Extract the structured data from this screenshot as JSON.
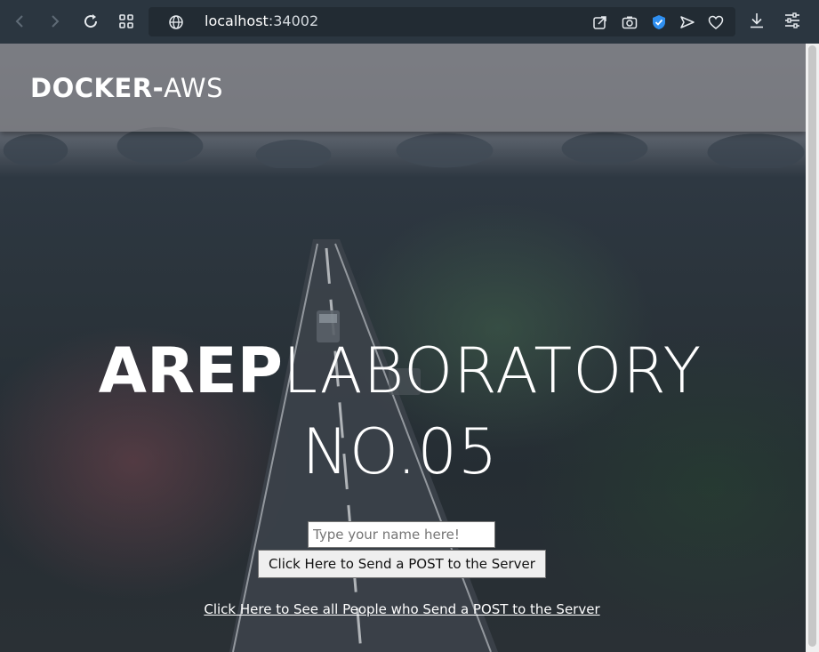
{
  "browser": {
    "url_host": "localhost",
    "url_port": ":34002",
    "icons": {
      "back": "back-arrow-icon",
      "forward": "forward-arrow-icon",
      "reload": "reload-icon",
      "tabs": "tab-grid-icon",
      "site": "globe-icon",
      "share": "share-icon",
      "screenshot": "camera-icon",
      "shield": "shield-check-icon",
      "send": "send-icon",
      "favorite": "heart-icon",
      "download": "download-icon",
      "menu": "sliders-icon"
    },
    "accent_color": "#2f8ff0"
  },
  "header": {
    "brand_bold": "DOCKER-",
    "brand_light": "AWS"
  },
  "hero": {
    "title_bold": "AREP",
    "title_light": "LABORATORY",
    "subtitle": "NO.05"
  },
  "form": {
    "name_placeholder": "Type your name here!",
    "name_value": "",
    "submit_label": "Click Here to Send a POST to the Server"
  },
  "links": {
    "people_label": "Click Here to See all People who Send a POST to the Server"
  }
}
